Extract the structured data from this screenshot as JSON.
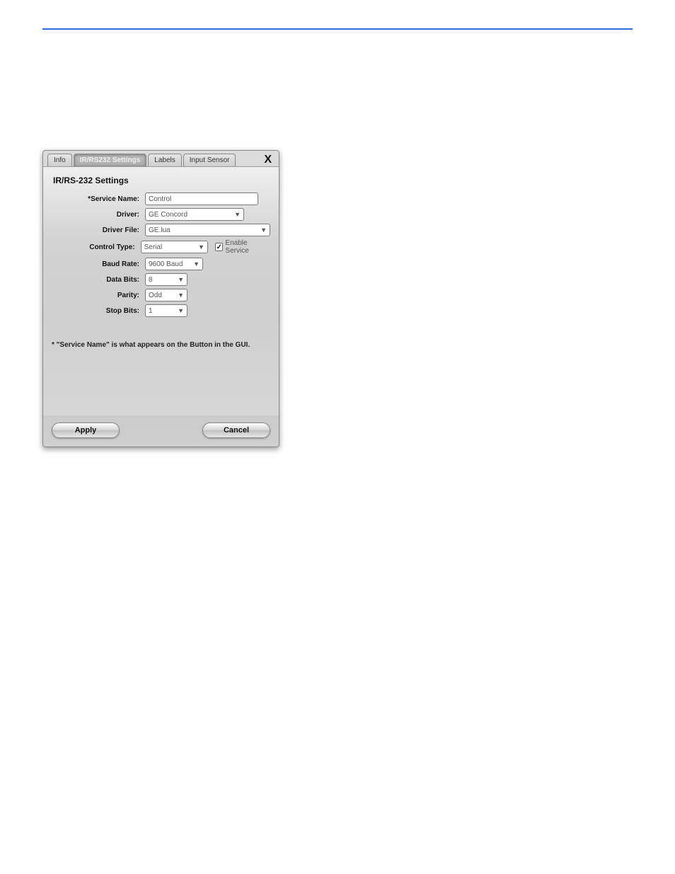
{
  "tabs": {
    "info": "Info",
    "settings": "IR/RS232 Settings",
    "labels": "Labels",
    "input_sensor": "Input Sensor"
  },
  "close_label": "X",
  "panel": {
    "title": "IR/RS-232 Settings",
    "service_name_label": "*Service Name:",
    "service_name_value": "Control",
    "driver_label": "Driver:",
    "driver_value": "GE Concord",
    "driver_file_label": "Driver File:",
    "driver_file_value": "GE.lua",
    "control_type_label": "Control Type:",
    "control_type_value": "Serial",
    "enable_service_label": "Enable Service",
    "enable_service_checked": true,
    "baud_rate_label": "Baud Rate:",
    "baud_rate_value": "9600 Baud",
    "data_bits_label": "Data Bits:",
    "data_bits_value": "8",
    "parity_label": "Parity:",
    "parity_value": "Odd",
    "stop_bits_label": "Stop Bits:",
    "stop_bits_value": "1",
    "note": "* \"Service Name\" is what appears on the Button in the GUI."
  },
  "buttons": {
    "apply": "Apply",
    "cancel": "Cancel"
  }
}
